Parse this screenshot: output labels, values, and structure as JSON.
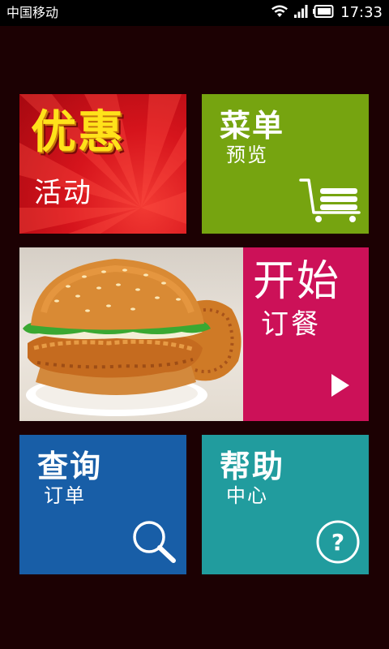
{
  "status_bar": {
    "carrier": "中国移动",
    "time": "17:33",
    "icons": [
      "wifi-icon",
      "signal-icon",
      "battery-icon"
    ]
  },
  "tiles": {
    "promotions": {
      "title": "优惠",
      "subtitle": "活动",
      "color": "#d6141c"
    },
    "menu": {
      "title": "菜单",
      "subtitle": "预览",
      "color": "#76a410",
      "icon": "cart-icon"
    },
    "order": {
      "title": "开始",
      "subtitle": "订餐",
      "color": "#cc1158",
      "icon": "play-arrow-icon",
      "image": "chicken-burger-photo"
    },
    "query": {
      "title": "查询",
      "subtitle": "订单",
      "color": "#185ea7",
      "icon": "search-icon"
    },
    "help": {
      "title": "帮助",
      "subtitle": "中心",
      "color": "#219c9e",
      "icon": "help-icon"
    }
  },
  "colors": {
    "background": "#1c0103",
    "status_bar": "#000000"
  }
}
